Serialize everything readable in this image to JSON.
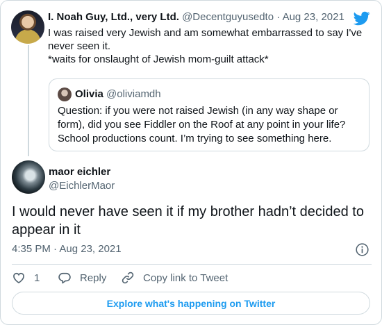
{
  "colors": {
    "accent": "#1d9bf0",
    "secondary_text": "#536471",
    "border": "#cfd9de"
  },
  "parent_tweet": {
    "author_name": "I. Noah Guy, Ltd., very Ltd.",
    "handle": "@Decentguyusedto",
    "separator": "·",
    "date": "Aug 23, 2021",
    "text": "I was raised very Jewish and am somewhat embarrassed to say I've never seen it.\n*waits for onslaught of Jewish mom-guilt attack*",
    "logo_icon": "twitter-bird-icon"
  },
  "quoted_tweet": {
    "author_name": "Olivia",
    "handle": "@oliviamdh",
    "text": "Question: if you were not raised Jewish (in any way shape or form), did you see Fiddler on the Roof at any point in your life? School productions count. I’m trying to see something here."
  },
  "main_tweet": {
    "author_name": "maor eichler",
    "handle": "@EichlerMaor",
    "text": "I would never have seen it if my brother hadn’t decided to appear in it",
    "timestamp": "4:35 PM · Aug 23, 2021",
    "info_icon": "info-icon"
  },
  "actions": {
    "like_count": "1",
    "reply_label": "Reply",
    "copy_link_label": "Copy link to Tweet"
  },
  "footer": {
    "explore_label": "Explore what's happening on Twitter"
  }
}
